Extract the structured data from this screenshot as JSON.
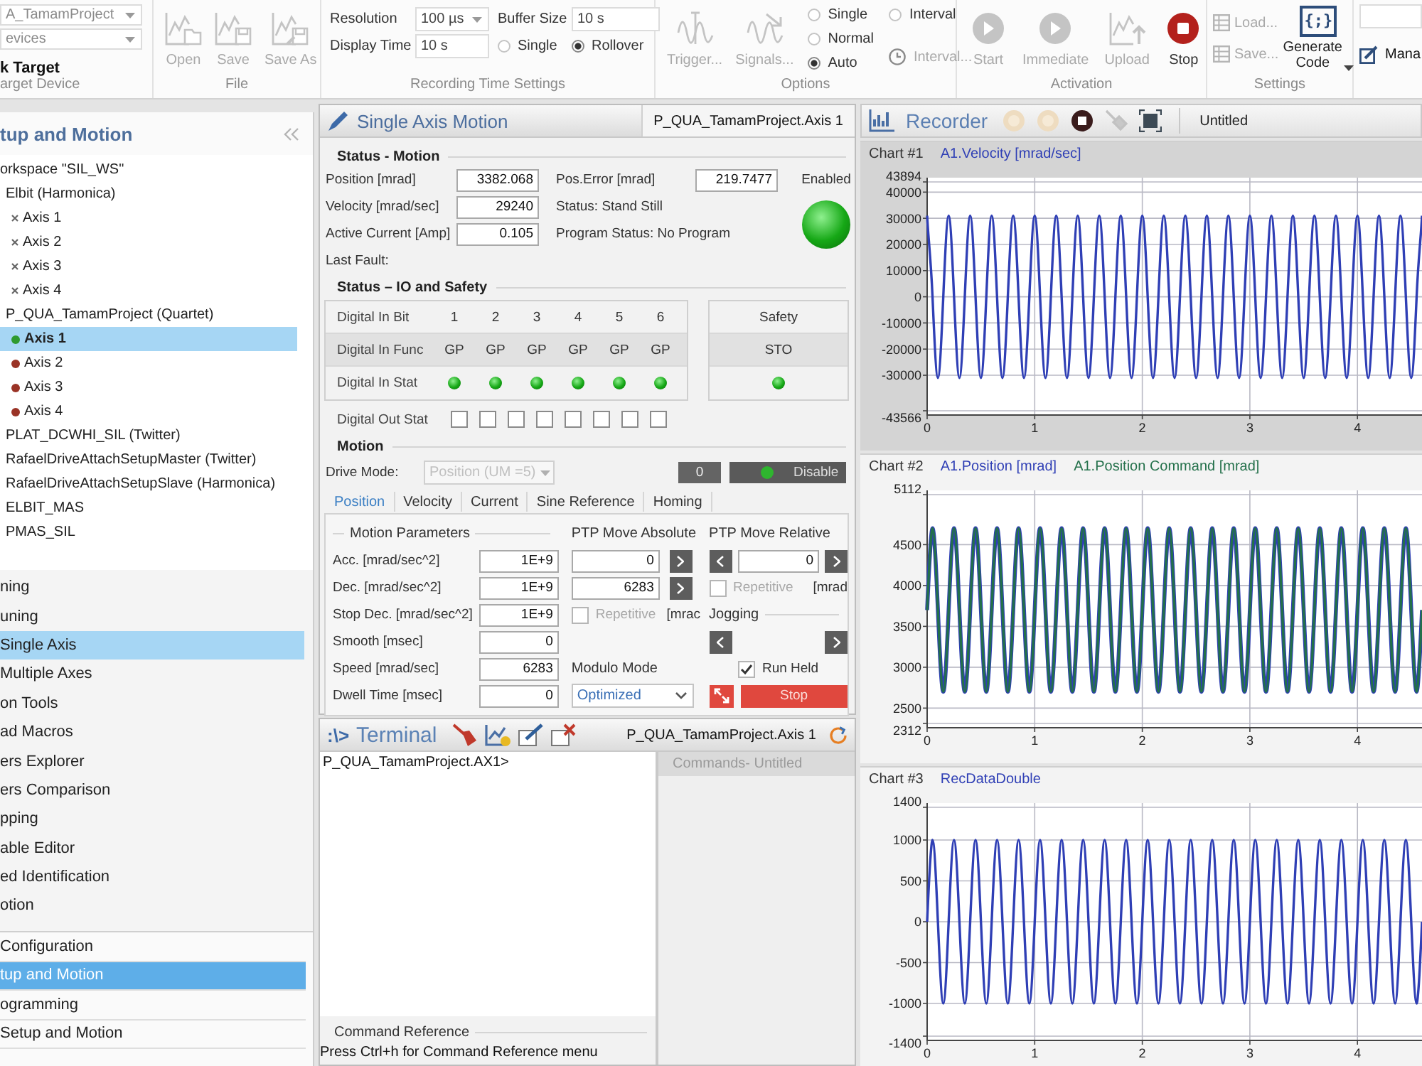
{
  "ribbon": {
    "target": {
      "project": "A_TamamProject",
      "devices": "evices",
      "link": "k Target",
      "group_label": "arget Device"
    },
    "file": {
      "buttons": [
        {
          "label": "Open",
          "kind": "open",
          "disabled": true
        },
        {
          "label": "Save",
          "kind": "save",
          "disabled": true
        },
        {
          "label": "Save As",
          "kind": "save-as",
          "disabled": true
        }
      ],
      "group_label": "File"
    },
    "recording": {
      "resolution": {
        "label": "Resolution",
        "value": "100 µs"
      },
      "buffer_size": {
        "label": "Buffer Size",
        "value": "10 s"
      },
      "display_time": {
        "label": "Display Time",
        "value": "10 s"
      },
      "modes": [
        {
          "label": "Single",
          "selected": false
        },
        {
          "label": "Rollover",
          "selected": true
        }
      ],
      "group_label": "Recording Time Settings"
    },
    "options": {
      "buttons": [
        {
          "label": "Trigger...",
          "kind": "trigger",
          "disabled": true
        },
        {
          "label": "Signals...",
          "kind": "signals",
          "disabled": true
        }
      ],
      "trigger_modes": [
        {
          "label": "Single",
          "selected": false
        },
        {
          "label": "Normal",
          "selected": false
        },
        {
          "label": "Auto",
          "selected": true
        }
      ],
      "interval_radio": {
        "label": "Interval",
        "selected": false
      },
      "interval_button": {
        "label": "Interval...",
        "disabled": true
      },
      "group_label": "Options"
    },
    "activation": {
      "buttons": [
        {
          "label": "Start",
          "kind": "play",
          "disabled": true
        },
        {
          "label": "Immediate",
          "kind": "play",
          "disabled": true
        },
        {
          "label": "Upload",
          "kind": "upload",
          "disabled": true
        },
        {
          "label": "Stop",
          "kind": "stop",
          "disabled": false
        }
      ],
      "group_label": "Activation"
    },
    "settings": {
      "buttons": [
        {
          "label": "Load...",
          "disabled": true
        },
        {
          "label": "Save...",
          "disabled": true
        }
      ],
      "generate": {
        "symbol": "{;}",
        "label": "Generate Code"
      },
      "group_label": "Settings"
    },
    "manage": {
      "label": "Mana"
    }
  },
  "sidebar": {
    "title": "tup and Motion",
    "tree": [
      {
        "label": "orkspace \"SIL_WS\"",
        "selected": false,
        "children": [
          {
            "label": "Elbit (Harmonica)",
            "selected": false,
            "children": [
              {
                "label": "Axis 1",
                "connected": false,
                "selected": false
              },
              {
                "label": "Axis 2",
                "connected": false,
                "selected": false
              },
              {
                "label": "Axis 3",
                "connected": false,
                "selected": false
              },
              {
                "label": "Axis 4",
                "connected": false,
                "selected": false
              }
            ]
          },
          {
            "label": "P_QUA_TamamProject (Quartet)",
            "selected": false,
            "children": [
              {
                "label": "Axis 1",
                "connected": true,
                "color": "#2f9a2f",
                "selected": true
              },
              {
                "label": "Axis 2",
                "connected": true,
                "color": "#9a3326",
                "selected": false
              },
              {
                "label": "Axis 3",
                "connected": true,
                "color": "#9a3326",
                "selected": false
              },
              {
                "label": "Axis 4",
                "connected": true,
                "color": "#9a3326",
                "selected": false
              }
            ]
          },
          {
            "label": "PLAT_DCWHI_SIL (Twitter)",
            "selected": false
          },
          {
            "label": "RafaelDriveAttachSetupMaster (Twitter)",
            "selected": false
          },
          {
            "label": "RafaelDriveAttachSetupSlave (Harmonica)",
            "selected": false
          },
          {
            "label": "ELBIT_MAS",
            "selected": false
          },
          {
            "label": "PMAS_SIL",
            "selected": false
          }
        ]
      }
    ],
    "nav": [
      {
        "label": "ning",
        "selected": false
      },
      {
        "label": "uning",
        "selected": false
      },
      {
        "label": "Single Axis",
        "selected": true
      },
      {
        "label": "Multiple Axes",
        "selected": false
      },
      {
        "label": "on Tools",
        "selected": false
      },
      {
        "label": "ad Macros",
        "selected": false
      },
      {
        "label": "ers Explorer",
        "selected": false
      },
      {
        "label": "ers Comparison",
        "selected": false
      },
      {
        "label": "pping",
        "selected": false
      },
      {
        "label": "able Editor",
        "selected": false
      },
      {
        "label": "ed Identification",
        "selected": false
      },
      {
        "label": "otion",
        "selected": false
      }
    ],
    "sections": [
      {
        "label": "Configuration",
        "selected": false
      },
      {
        "label": "tup and Motion",
        "selected": true
      },
      {
        "label": "ogramming",
        "selected": false
      },
      {
        "label": "Setup and Motion",
        "selected": false
      }
    ]
  },
  "motion_panel": {
    "title": "Single Axis Motion",
    "axis": "P_QUA_TamamProject.Axis 1",
    "status_motion": {
      "title": "Status - Motion",
      "fields": [
        {
          "label": "Position [mrad]",
          "value": "3382.068"
        },
        {
          "label": "Velocity [mrad/sec]",
          "value": "29240"
        },
        {
          "label": "Active Current [Amp]",
          "value": "0.105"
        }
      ],
      "last_fault": "Last Fault:",
      "pos_error": {
        "label": "Pos.Error [mrad]",
        "value": "219.7477"
      },
      "status": "Status: Stand Still",
      "program_status": "Program Status: No Program",
      "enabled": {
        "label": "Enabled",
        "on": true
      }
    },
    "status_io": {
      "title": "Status – IO and Safety",
      "inputs": {
        "bit_label": "Digital In Bit",
        "func_label": "Digital In Func",
        "stat_label": "Digital In Stat",
        "bits": [
          {
            "bit": "1",
            "func": "GP",
            "on": true
          },
          {
            "bit": "2",
            "func": "GP",
            "on": true
          },
          {
            "bit": "3",
            "func": "GP",
            "on": true
          },
          {
            "bit": "4",
            "func": "GP",
            "on": true
          },
          {
            "bit": "5",
            "func": "GP",
            "on": true
          },
          {
            "bit": "6",
            "func": "GP",
            "on": true
          }
        ]
      },
      "safety": {
        "title": "Safety",
        "func": "STO",
        "on": true
      },
      "outputs": {
        "label": "Digital Out Stat",
        "bits": [
          {
            "checked": false
          },
          {
            "checked": false
          },
          {
            "checked": false
          },
          {
            "checked": false
          },
          {
            "checked": false
          },
          {
            "checked": false
          },
          {
            "checked": false
          },
          {
            "checked": false
          }
        ]
      }
    },
    "motion": {
      "title": "Motion",
      "drive_mode": {
        "label": "Drive Mode:",
        "value": "Position (UM =5)",
        "disabled": true
      },
      "zero_button": "0",
      "disable_button": {
        "label": "Disable",
        "on": true
      },
      "tabs": [
        {
          "label": "Position",
          "selected": true
        },
        {
          "label": "Velocity",
          "selected": false
        },
        {
          "label": "Current",
          "selected": false
        },
        {
          "label": "Sine Reference",
          "selected": false
        },
        {
          "label": "Homing",
          "selected": false
        }
      ],
      "parameters": {
        "title": "Motion Parameters",
        "rows": [
          {
            "label": "Acc. [mrad/sec^2]",
            "value": "1E+9"
          },
          {
            "label": "Dec. [mrad/sec^2]",
            "value": "1E+9"
          },
          {
            "label": "Stop Dec. [mrad/sec^2]",
            "value": "1E+9"
          },
          {
            "label": "Smooth [msec]",
            "value": "0"
          },
          {
            "label": "Speed [mrad/sec]",
            "value": "6283"
          },
          {
            "label": "Dwell Time [msec]",
            "value": "0"
          }
        ]
      },
      "absolute": {
        "title": "PTP Move Absolute",
        "targets": [
          "0",
          "6283"
        ],
        "repetitive": {
          "label": "Repetitive",
          "checked": false,
          "disabled": true
        },
        "unit": "[mrac"
      },
      "modulo": {
        "label": "Modulo Mode",
        "value": "Optimized"
      },
      "relative": {
        "title": "PTP Move Relative",
        "target": "0",
        "repetitive": {
          "label": "Repetitive",
          "checked": false,
          "disabled": true
        },
        "unit": "[mrad"
      },
      "jogging": {
        "title": "Jogging",
        "run_held": {
          "label": "Run Held",
          "checked": true,
          "disabled": false
        }
      },
      "stop_button": "Stop"
    }
  },
  "terminal": {
    "prompt_symbol": ":\\>",
    "title": "Terminal",
    "axis": "P_QUA_TamamProject.Axis 1",
    "output": "P_QUA_TamamProject.AX1>",
    "commands_title": "Commands- Untitled",
    "reference_title": "Command Reference",
    "reference_hint": "Press Ctrl+h for Command Reference menu"
  },
  "recorder": {
    "title": "Recorder",
    "tools": [
      {
        "kind": "start",
        "disabled": true
      },
      {
        "kind": "trigger",
        "disabled": true
      },
      {
        "kind": "stop",
        "disabled": false
      },
      {
        "kind": "probe",
        "disabled": true
      },
      {
        "kind": "fit",
        "disabled": false
      }
    ],
    "file": "Untitled",
    "charts": [
      {
        "selected": true,
        "chart_data": {
          "type": "line",
          "title": "Chart #1",
          "grid": true,
          "x": [
            0,
            0.05,
            0.1,
            0.15,
            0.2,
            0.25,
            0.3,
            0.35,
            0.4,
            0.45,
            0.5,
            0.55,
            0.6,
            0.65,
            0.7,
            0.75,
            0.8,
            0.85,
            0.9,
            0.95,
            1,
            1.05,
            1.1,
            1.15,
            1.2,
            1.25,
            1.3,
            1.35,
            1.4,
            1.45,
            1.5,
            1.55,
            1.6,
            1.65,
            1.7,
            1.75,
            1.8,
            1.85,
            1.9,
            1.95,
            2,
            2.05,
            2.1,
            2.15,
            2.2,
            2.25,
            2.3,
            2.35,
            2.4,
            2.45,
            2.5,
            2.55,
            2.6,
            2.65,
            2.7,
            2.75,
            2.8,
            2.85,
            2.9,
            2.95,
            3,
            3.05,
            3.1,
            3.15,
            3.2,
            3.25,
            3.3,
            3.35,
            3.4,
            3.45,
            3.5,
            3.55,
            3.6,
            3.65,
            3.7,
            3.75,
            3.8,
            3.85,
            3.9,
            3.95,
            4,
            4.05,
            4.1,
            4.15,
            4.2,
            4.25,
            4.3,
            4.35,
            4.4,
            4.45,
            4.5,
            4.55,
            4.6
          ],
          "xlim": [
            0,
            4.6
          ],
          "ylim": [
            -43566,
            43894
          ],
          "xticks": [
            0,
            1,
            2,
            3,
            4
          ],
          "yticks": [
            -43566,
            -30000,
            -20000,
            -10000,
            0,
            10000,
            20000,
            30000,
            40000,
            43894
          ],
          "series": [
            {
              "name": "A1.Velocity [mrad/sec]",
              "color": "#2f3fb5",
              "values": [
                31000,
                0,
                -31000,
                0,
                31000,
                0,
                -31000,
                0,
                31000,
                0,
                -31000,
                0,
                31000,
                0,
                -31000,
                0,
                31000,
                0,
                -31000,
                0,
                31000,
                0,
                -31000,
                0,
                31000,
                0,
                -31000,
                0,
                31000,
                0,
                -31000,
                0,
                31000,
                0,
                -31000,
                0,
                31000,
                0,
                -31000,
                0,
                31000,
                0,
                -31000,
                0,
                31000,
                0,
                -31000,
                0,
                31000,
                0,
                -31000,
                0,
                31000,
                0,
                -31000,
                0,
                31000,
                0,
                -31000,
                0,
                31000,
                0,
                -31000,
                0,
                31000,
                0,
                -31000,
                0,
                31000,
                0,
                -31000,
                0,
                31000,
                0,
                -31000,
                0,
                31000,
                0,
                -31000,
                0,
                31000,
                0,
                -31000,
                0,
                31000,
                0,
                -31000,
                0,
                31000,
                0,
                -31000,
                0,
                31000
              ]
            }
          ]
        }
      },
      {
        "selected": false,
        "chart_data": {
          "type": "line",
          "title": "Chart #2",
          "grid": true,
          "x": [
            0,
            0.05,
            0.1,
            0.15,
            0.2,
            0.25,
            0.3,
            0.35,
            0.4,
            0.45,
            0.5,
            0.55,
            0.6,
            0.65,
            0.7,
            0.75,
            0.8,
            0.85,
            0.9,
            0.95,
            1,
            1.05,
            1.1,
            1.15,
            1.2,
            1.25,
            1.3,
            1.35,
            1.4,
            1.45,
            1.5,
            1.55,
            1.6,
            1.65,
            1.7,
            1.75,
            1.8,
            1.85,
            1.9,
            1.95,
            2,
            2.05,
            2.1,
            2.15,
            2.2,
            2.25,
            2.3,
            2.35,
            2.4,
            2.45,
            2.5,
            2.55,
            2.6,
            2.65,
            2.7,
            2.75,
            2.8,
            2.85,
            2.9,
            2.95,
            3,
            3.05,
            3.1,
            3.15,
            3.2,
            3.25,
            3.3,
            3.35,
            3.4,
            3.45,
            3.5,
            3.55,
            3.6,
            3.65,
            3.7,
            3.75,
            3.8,
            3.85,
            3.9,
            3.95,
            4,
            4.05,
            4.1,
            4.15,
            4.2,
            4.25,
            4.3,
            4.35,
            4.4,
            4.45,
            4.5,
            4.55,
            4.6
          ],
          "xlim": [
            0,
            4.6
          ],
          "ylim": [
            2312,
            5112
          ],
          "xticks": [
            0,
            1,
            2,
            3,
            4
          ],
          "yticks": [
            2312,
            2500,
            3000,
            3500,
            4000,
            4500,
            5112
          ],
          "series": [
            {
              "name": "A1.Position [mrad]",
              "color": "#2f3fb5",
              "values": [
                3700,
                4700,
                3700,
                2700,
                3700,
                4700,
                3700,
                2700,
                3700,
                4700,
                3700,
                2700,
                3700,
                4700,
                3700,
                2700,
                3700,
                4700,
                3700,
                2700,
                3700,
                4700,
                3700,
                2700,
                3700,
                4700,
                3700,
                2700,
                3700,
                4700,
                3700,
                2700,
                3700,
                4700,
                3700,
                2700,
                3700,
                4700,
                3700,
                2700,
                3700,
                4700,
                3700,
                2700,
                3700,
                4700,
                3700,
                2700,
                3700,
                4700,
                3700,
                2700,
                3700,
                4700,
                3700,
                2700,
                3700,
                4700,
                3700,
                2700,
                3700,
                4700,
                3700,
                2700,
                3700,
                4700,
                3700,
                2700,
                3700,
                4700,
                3700,
                2700,
                3700,
                4700,
                3700,
                2700,
                3700,
                4700,
                3700,
                2700,
                3700,
                4700,
                3700,
                2700,
                3700,
                4700,
                3700,
                2700,
                3700,
                4700,
                3700,
                2700,
                3700
              ]
            },
            {
              "name": "A1.Position Command [mrad]",
              "color": "#23704a",
              "values": [
                3700,
                4700,
                3700,
                2700,
                3700,
                4700,
                3700,
                2700,
                3700,
                4700,
                3700,
                2700,
                3700,
                4700,
                3700,
                2700,
                3700,
                4700,
                3700,
                2700,
                3700,
                4700,
                3700,
                2700,
                3700,
                4700,
                3700,
                2700,
                3700,
                4700,
                3700,
                2700,
                3700,
                4700,
                3700,
                2700,
                3700,
                4700,
                3700,
                2700,
                3700,
                4700,
                3700,
                2700,
                3700,
                4700,
                3700,
                2700,
                3700,
                4700,
                3700,
                2700,
                3700,
                4700,
                3700,
                2700,
                3700,
                4700,
                3700,
                2700,
                3700,
                4700,
                3700,
                2700,
                3700,
                4700,
                3700,
                2700,
                3700,
                4700,
                3700,
                2700,
                3700,
                4700,
                3700,
                2700,
                3700,
                4700,
                3700,
                2700,
                3700,
                4700,
                3700,
                2700,
                3700,
                4700,
                3700,
                2700,
                3700,
                4700,
                3700,
                2700,
                3700
              ]
            }
          ]
        }
      },
      {
        "selected": false,
        "chart_data": {
          "type": "line",
          "title": "Chart #3",
          "grid": true,
          "x": [
            0,
            0.05,
            0.1,
            0.15,
            0.2,
            0.25,
            0.3,
            0.35,
            0.4,
            0.45,
            0.5,
            0.55,
            0.6,
            0.65,
            0.7,
            0.75,
            0.8,
            0.85,
            0.9,
            0.95,
            1,
            1.05,
            1.1,
            1.15,
            1.2,
            1.25,
            1.3,
            1.35,
            1.4,
            1.45,
            1.5,
            1.55,
            1.6,
            1.65,
            1.7,
            1.75,
            1.8,
            1.85,
            1.9,
            1.95,
            2,
            2.05,
            2.1,
            2.15,
            2.2,
            2.25,
            2.3,
            2.35,
            2.4,
            2.45,
            2.5,
            2.55,
            2.6,
            2.65,
            2.7,
            2.75,
            2.8,
            2.85,
            2.9,
            2.95,
            3,
            3.05,
            3.1,
            3.15,
            3.2,
            3.25,
            3.3,
            3.35,
            3.4,
            3.45,
            3.5,
            3.55,
            3.6,
            3.65,
            3.7,
            3.75,
            3.8,
            3.85,
            3.9,
            3.95,
            4,
            4.05,
            4.1,
            4.15,
            4.2,
            4.25,
            4.3,
            4.35,
            4.4,
            4.45,
            4.5,
            4.55,
            4.6
          ],
          "xlim": [
            0,
            4.6
          ],
          "ylim": [
            -1400,
            1400
          ],
          "xticks": [
            0,
            1,
            2,
            3,
            4
          ],
          "yticks": [
            -1400,
            -1000,
            -500,
            0,
            500,
            1000,
            1400
          ],
          "series": [
            {
              "name": "RecDataDouble",
              "color": "#2f3fb5",
              "values": [
                0,
                1000,
                0,
                -1000,
                0,
                1000,
                0,
                -1000,
                0,
                1000,
                0,
                -1000,
                0,
                1000,
                0,
                -1000,
                0,
                1000,
                0,
                -1000,
                0,
                1000,
                0,
                -1000,
                0,
                1000,
                0,
                -1000,
                0,
                1000,
                0,
                -1000,
                0,
                1000,
                0,
                -1000,
                0,
                1000,
                0,
                -1000,
                0,
                1000,
                0,
                -1000,
                0,
                1000,
                0,
                -1000,
                0,
                1000,
                0,
                -1000,
                0,
                1000,
                0,
                -1000,
                0,
                1000,
                0,
                -1000,
                0,
                1000,
                0,
                -1000,
                0,
                1000,
                0,
                -1000,
                0,
                1000,
                0,
                -1000,
                0,
                1000,
                0,
                -1000,
                0,
                1000,
                0,
                -1000,
                0,
                1000,
                0,
                -1000,
                0,
                1000,
                0,
                -1000,
                0,
                1000,
                0,
                -1000,
                0
              ]
            }
          ]
        }
      }
    ]
  }
}
